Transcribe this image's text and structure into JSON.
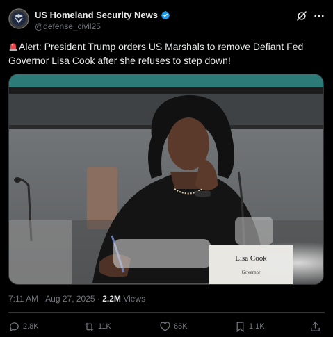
{
  "account": {
    "name": "US Homeland Security News",
    "handle": "@defense_civil25",
    "verified": true
  },
  "tweet": {
    "text": "Alert: President Trump orders US Marshals to remove Defiant Fed Governor Lisa Cook after she refuses to step down!",
    "emoji_icon": "police-car-light"
  },
  "media": {
    "nameplate_name": "Lisa Cook",
    "nameplate_title": "Governor"
  },
  "meta": {
    "time": "7:11 AM",
    "separator": "·",
    "date": "Aug 27, 2025",
    "views_count": "2.2M",
    "views_label": "Views"
  },
  "actions": {
    "replies": "2.8K",
    "reposts": "11K",
    "likes": "65K",
    "bookmarks": "1.1K"
  },
  "colors": {
    "background": "#000000",
    "text": "#e7e9ea",
    "secondary": "#71767b",
    "verified": "#1d9bf0",
    "divider": "#2f3336"
  }
}
